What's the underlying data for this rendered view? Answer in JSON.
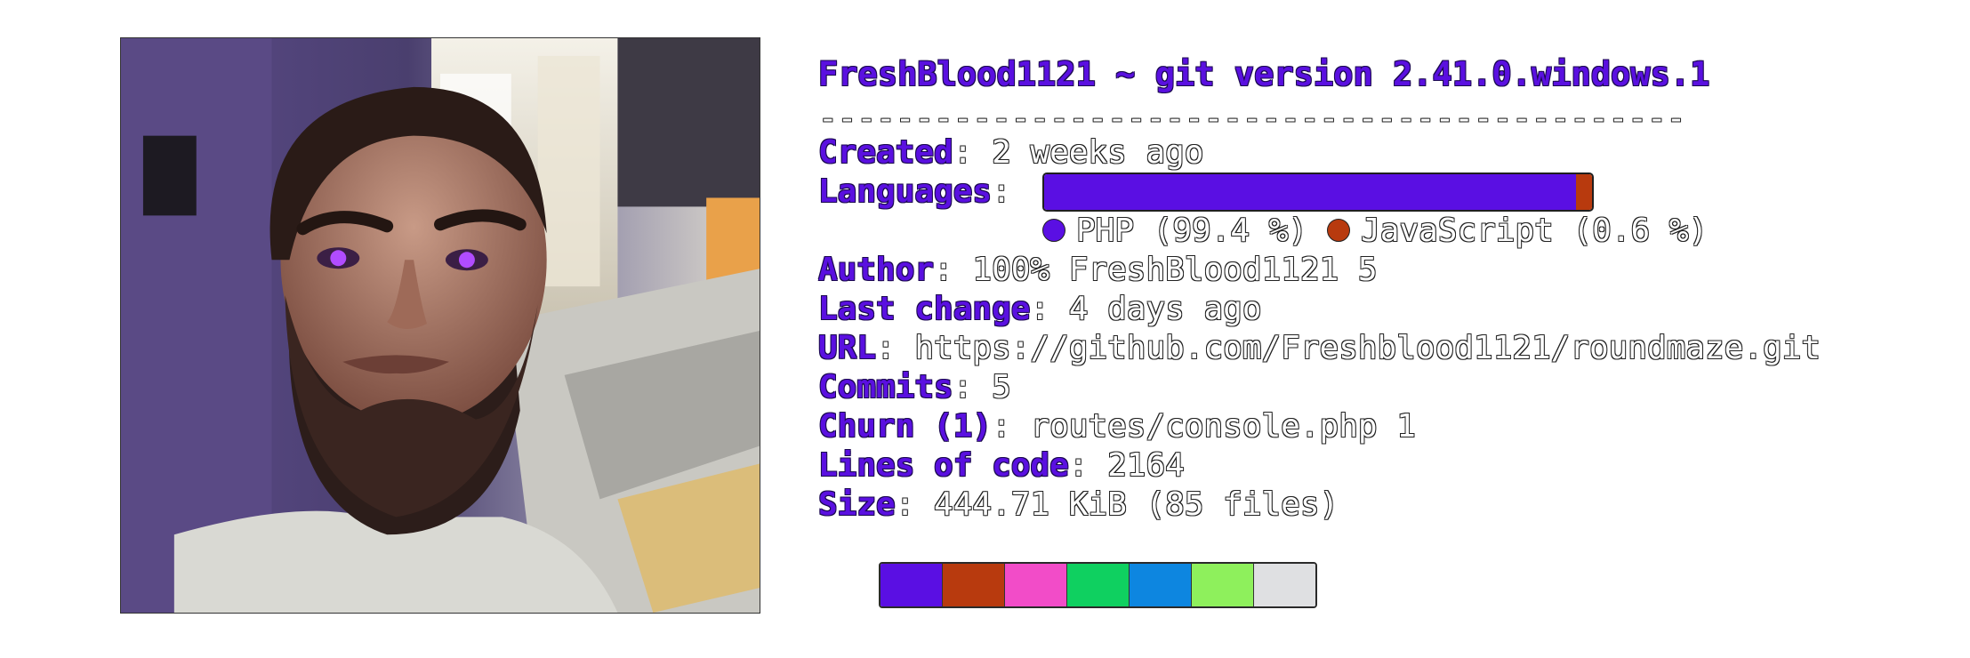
{
  "header": {
    "title": "FreshBlood1121 ~ git version 2.41.0.windows.1",
    "separator": "---------------------------------------------"
  },
  "info": [
    {
      "key": "Created",
      "value": ": 2 weeks ago"
    },
    {
      "key": "Languages",
      "value": ":"
    },
    {
      "key": "Author",
      "value": ": 100% FreshBlood1121 5"
    },
    {
      "key": "Last change",
      "value": ": 4 days ago"
    },
    {
      "key": "URL",
      "value": ": https://github.com/Freshblood1121/roundmaze.git"
    },
    {
      "key": "Commits",
      "value": ": 5"
    },
    {
      "key": "Churn (1)",
      "value": ": routes/console.php 1"
    },
    {
      "key": "Lines of code",
      "value": ": 2164"
    },
    {
      "key": "Size",
      "value": ": 444.71 KiB (85 files)"
    }
  ],
  "languages": [
    {
      "name": "PHP",
      "label": "PHP (99.4 %)",
      "percent": 99.4,
      "color": "#5a0fe3"
    },
    {
      "name": "JavaScript",
      "label": "JavaScript (0.6 %)",
      "percent": 0.6,
      "color": "#b83a0e"
    }
  ],
  "palette": [
    "#5a0fe3",
    "#b83a0e",
    "#f24cc8",
    "#0fd060",
    "#0d86e0",
    "#8ef05c",
    "#dfe0e2"
  ],
  "avatar": {
    "description_icon": "avatar-portrait-icon"
  }
}
